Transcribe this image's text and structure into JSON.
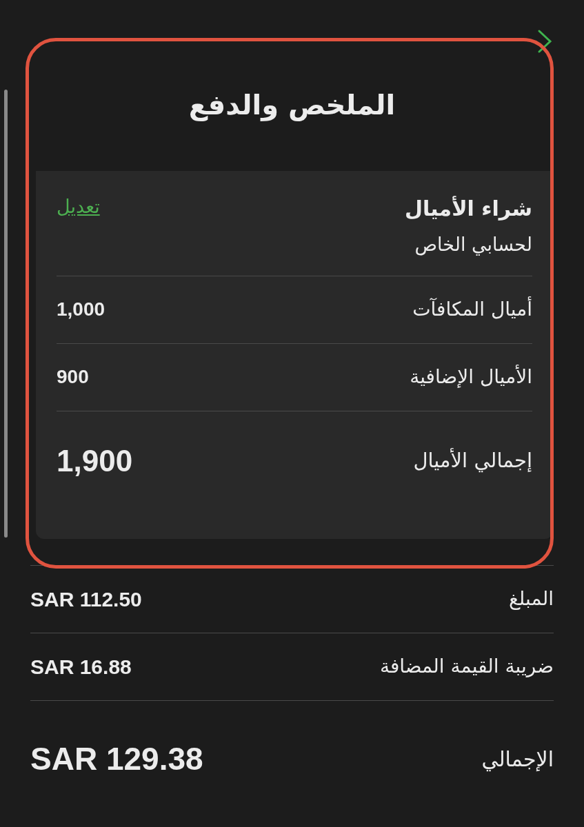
{
  "header": {
    "title": "الملخص والدفع"
  },
  "purchase": {
    "title": "شراء الأميال",
    "subtitle": "لحسابي الخاص",
    "edit_link": "تعديل"
  },
  "miles_rows": [
    {
      "label": "أميال المكافآت",
      "value": "1,000"
    },
    {
      "label": "الأميال الإضافية",
      "value": "900"
    }
  ],
  "miles_total": {
    "label": "إجمالي الأميال",
    "value": "1,900"
  },
  "payment_rows": [
    {
      "label": "المبلغ",
      "value": "SAR 112.50"
    },
    {
      "label": "ضريبة القيمة المضافة",
      "value": "SAR 16.88"
    }
  ],
  "payment_total": {
    "label": "الإجمالي",
    "value": "SAR 129.38"
  }
}
